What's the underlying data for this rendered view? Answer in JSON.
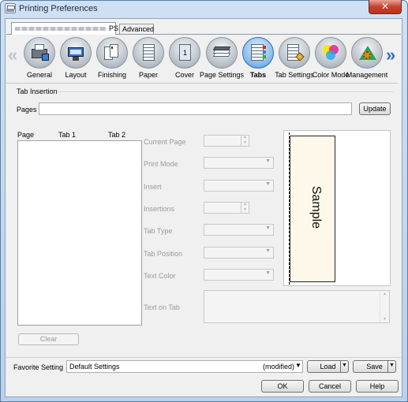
{
  "window": {
    "title": "Printing Preferences",
    "close_label": "✕"
  },
  "top_tabs": {
    "ps_label": "PS",
    "advanced_label": "Advanced"
  },
  "toolbar": {
    "items": [
      {
        "label": "General",
        "icon": "general-icon"
      },
      {
        "label": "Layout",
        "icon": "layout-icon"
      },
      {
        "label": "Finishing",
        "icon": "finishing-icon"
      },
      {
        "label": "Paper",
        "icon": "paper-icon"
      },
      {
        "label": "Cover",
        "icon": "cover-icon"
      },
      {
        "label": "Page Settings",
        "icon": "page-settings-icon"
      },
      {
        "label": "Tabs",
        "icon": "tabs-icon",
        "active": true
      },
      {
        "label": "Tab Settings",
        "icon": "tab-settings-icon"
      },
      {
        "label": "Color Mode",
        "icon": "color-mode-icon"
      },
      {
        "label": "Management",
        "icon": "management-icon"
      }
    ],
    "left_arrow": "«",
    "right_arrow": "»",
    "cover_number": "1"
  },
  "tab_insertion": {
    "group_label": "Tab Insertion",
    "pages_label": "Pages",
    "pages_value": "",
    "update_label": "Update",
    "columns": [
      "Page",
      "Tab 1",
      "Tab 2"
    ],
    "rows": [],
    "clear_label": "Clear"
  },
  "settings": {
    "current_page": "Current Page",
    "print_mode": "Print Mode",
    "insert": "Insert",
    "insertions": "Insertions",
    "tab_type": "Tab Type",
    "tab_position": "Tab Position",
    "text_color": "Text Color",
    "text_on_tab": "Text on Tab"
  },
  "preview": {
    "sample_text": "Sample"
  },
  "favorite": {
    "label": "Favorite Setting",
    "value": "Default Settings",
    "modified": "(modified)",
    "load_label": "Load",
    "save_label": "Save"
  },
  "dialog_buttons": {
    "ok": "OK",
    "cancel": "Cancel",
    "help": "Help"
  },
  "colors": {
    "active_tool": "#7fb6ea",
    "preview_tab_fill": "#fdf8e9",
    "close_button": "#c7432e"
  }
}
